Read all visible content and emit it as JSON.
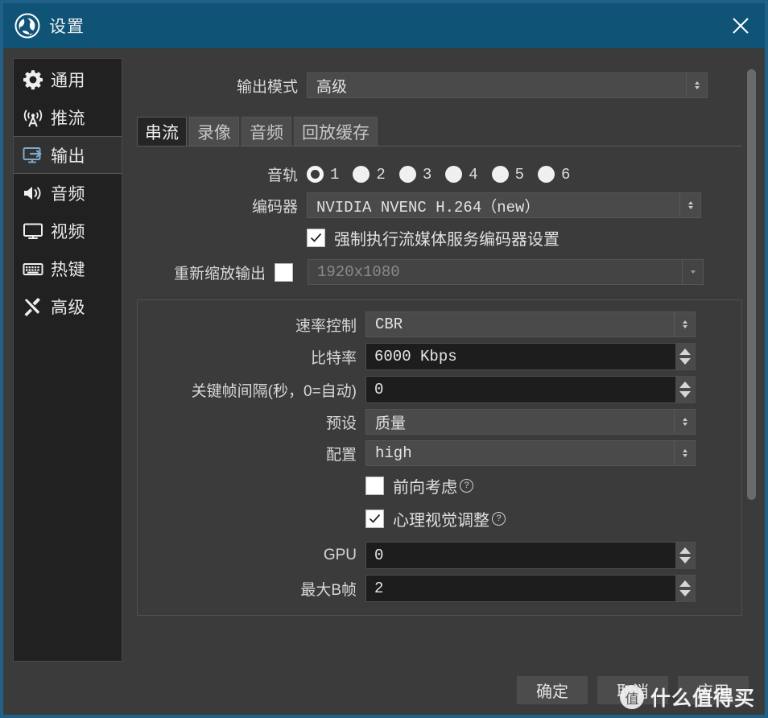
{
  "window": {
    "title": "设置",
    "logo_icon": "obs-logo-icon",
    "close_icon": "close-icon",
    "accent_color": "#0f5377",
    "border_color": "#1f6189"
  },
  "sidebar": {
    "items": [
      {
        "label": "通用",
        "icon": "gear-icon",
        "key": "general",
        "active": false
      },
      {
        "label": "推流",
        "icon": "broadcast-icon",
        "key": "stream",
        "active": false
      },
      {
        "label": "输出",
        "icon": "output-icon",
        "key": "output",
        "active": true
      },
      {
        "label": "音频",
        "icon": "speaker-icon",
        "key": "audio",
        "active": false
      },
      {
        "label": "视频",
        "icon": "monitor-icon",
        "key": "video",
        "active": false
      },
      {
        "label": "热键",
        "icon": "keyboard-icon",
        "key": "hotkeys",
        "active": false
      },
      {
        "label": "高级",
        "icon": "tools-icon",
        "key": "advanced",
        "active": false
      }
    ]
  },
  "output_mode": {
    "label": "输出模式",
    "value": "高级"
  },
  "tabs": [
    {
      "label": "串流",
      "active": true
    },
    {
      "label": "录像",
      "active": false
    },
    {
      "label": "音频",
      "active": false
    },
    {
      "label": "回放缓存",
      "active": false
    }
  ],
  "audio_track": {
    "label": "音轨",
    "options": [
      "1",
      "2",
      "3",
      "4",
      "5",
      "6"
    ],
    "selected": "1"
  },
  "encoder": {
    "label": "编码器",
    "value": "NVIDIA NVENC H.264（new）"
  },
  "enforce": {
    "label": "强制执行流媒体服务编码器设置",
    "checked": true
  },
  "rescale": {
    "label": "重新缩放输出",
    "checked": false,
    "value": "1920x1080",
    "disabled": true
  },
  "encoder_settings": {
    "rate_control": {
      "label": "速率控制",
      "value": "CBR"
    },
    "bitrate": {
      "label": "比特率",
      "value": "6000 Kbps"
    },
    "keyframe_interval": {
      "label": "关键帧间隔(秒，0=自动)",
      "value": "0"
    },
    "preset": {
      "label": "预设",
      "value": "质量"
    },
    "profile": {
      "label": "配置",
      "value": "high"
    },
    "look_ahead": {
      "label": "前向考虑",
      "checked": false,
      "help": "?"
    },
    "psycho_visual": {
      "label": "心理视觉调整",
      "checked": true,
      "help": "?"
    },
    "gpu": {
      "label": "GPU",
      "value": "0"
    },
    "max_b_frames": {
      "label": "最大B帧",
      "value": "2"
    }
  },
  "footer": {
    "ok": "确定",
    "cancel": "取消",
    "apply": "应用"
  },
  "watermark": {
    "logo_text": "值",
    "text": "什么值得买"
  }
}
